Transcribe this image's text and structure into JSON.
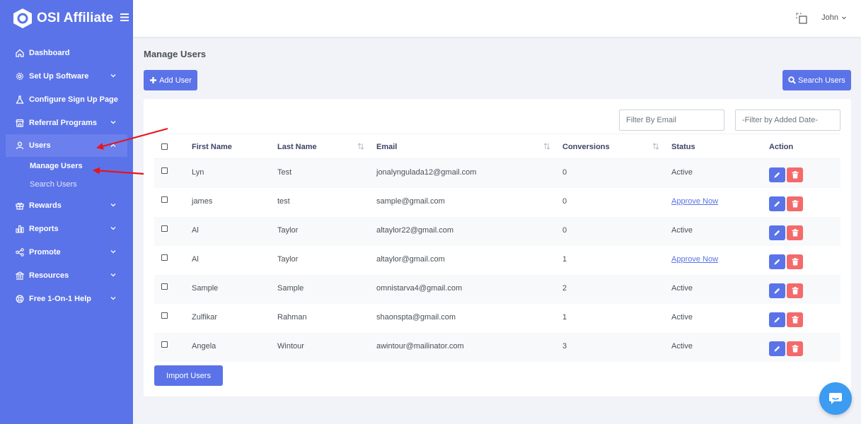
{
  "brand": {
    "name": "OSI Affiliate"
  },
  "sidebar": {
    "items": [
      {
        "label": "Dashboard",
        "icon": "home-icon"
      },
      {
        "label": "Set Up Software",
        "icon": "gear-icon"
      },
      {
        "label": "Configure Sign Up Page",
        "icon": "flask-icon"
      },
      {
        "label": "Referral Programs",
        "icon": "store-icon"
      },
      {
        "label": "Users",
        "icon": "user-icon"
      },
      {
        "label": "Rewards",
        "icon": "gift-icon"
      },
      {
        "label": "Reports",
        "icon": "bar-chart-icon"
      },
      {
        "label": "Promote",
        "icon": "share-icon"
      },
      {
        "label": "Resources",
        "icon": "bank-icon"
      },
      {
        "label": "Free 1-On-1 Help",
        "icon": "lifebuoy-icon"
      }
    ],
    "users_sub": [
      "Manage Users",
      "Search Users"
    ]
  },
  "topbar": {
    "user_name": "John"
  },
  "page": {
    "title": "Manage Users"
  },
  "toolbar": {
    "add_label": "Add User",
    "search_label": "Search Users",
    "import_label": "Import Users"
  },
  "filters": {
    "email_placeholder": "Filter By Email",
    "date_placeholder": "-Filter by Added Date-"
  },
  "table": {
    "headers": {
      "first": "First Name",
      "last": "Last Name",
      "email": "Email",
      "conversions": "Conversions",
      "status": "Status",
      "action": "Action"
    },
    "rows": [
      {
        "first": "Lyn",
        "last": "Test",
        "email": "jonalyngulada12@gmail.com",
        "conversions": "0",
        "status": "Active"
      },
      {
        "first": "james",
        "last": "test",
        "email": "sample@gmail.com",
        "conversions": "0",
        "status": "Approve Now"
      },
      {
        "first": "Al",
        "last": "Taylor",
        "email": "altaylor22@gmail.com",
        "conversions": "0",
        "status": "Active"
      },
      {
        "first": "Al",
        "last": "Taylor",
        "email": "altaylor@gmail.com",
        "conversions": "1",
        "status": "Approve Now"
      },
      {
        "first": "Sample",
        "last": "Sample",
        "email": "omnistarva4@gmail.com",
        "conversions": "2",
        "status": "Active"
      },
      {
        "first": "Zulfikar",
        "last": "Rahman",
        "email": "shaonspta@gmail.com",
        "conversions": "1",
        "status": "Active"
      },
      {
        "first": "Angela",
        "last": "Wintour",
        "email": "awintour@mailinator.com",
        "conversions": "3",
        "status": "Active"
      }
    ]
  },
  "colors": {
    "primary": "#5b73e8",
    "danger": "#f46a6a",
    "chat": "#3b9cf2",
    "annotation": "#e8141b"
  }
}
